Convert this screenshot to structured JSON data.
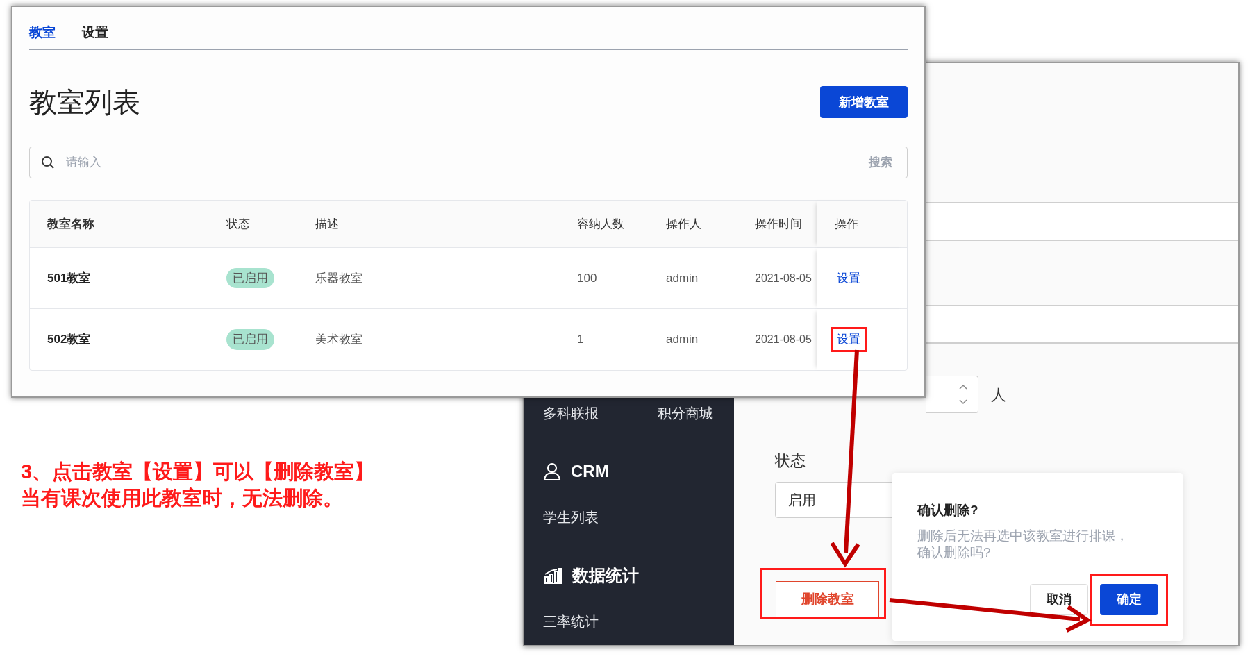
{
  "tutorial_note": {
    "lines": [
      "3、点击教室【设置】可以【删除教室】",
      "当有课次使用此教室时，无法删除。"
    ]
  },
  "classroom_window": {
    "tabs": [
      {
        "label": "教室",
        "selected": true
      },
      {
        "label": "设置",
        "selected": false
      }
    ],
    "title": "教室列表",
    "add_button": "新增教室",
    "search": {
      "placeholder": "请输入",
      "button": "搜索"
    },
    "table": {
      "columns": [
        "教室名称",
        "状态",
        "描述",
        "容纳人数",
        "操作人",
        "操作时间",
        "操作"
      ],
      "rows": [
        {
          "name": "501教室",
          "status": "已启用",
          "description": "乐器教室",
          "capacity": "100",
          "operator": "admin",
          "time": "2021-08-05",
          "action": "设置",
          "highlighted": false
        },
        {
          "name": "502教室",
          "status": "已启用",
          "description": "美术教室",
          "capacity": "1",
          "operator": "admin",
          "time": "2021-08-05",
          "action": "设置",
          "highlighted": true
        }
      ]
    }
  },
  "settings_window": {
    "sidebar": {
      "items": [
        {
          "kind": "pair",
          "labels": [
            "多科联报",
            "积分商城"
          ]
        },
        {
          "kind": "heading",
          "label": "CRM"
        },
        {
          "kind": "link",
          "label": "学生列表"
        },
        {
          "kind": "heading",
          "label": "数据统计"
        },
        {
          "kind": "link",
          "label": "三率统计"
        }
      ]
    },
    "capacity_unit": "人",
    "status_label": "状态",
    "status_value": "启用",
    "delete_button": {
      "label": "删除教室",
      "highlighted": true
    },
    "confirm_popover": {
      "title": "确认删除?",
      "message": "删除后无法再选中该教室进行排课，确认删除吗?",
      "cancel": "取消",
      "ok": "确定",
      "ok_highlighted": true
    }
  }
}
